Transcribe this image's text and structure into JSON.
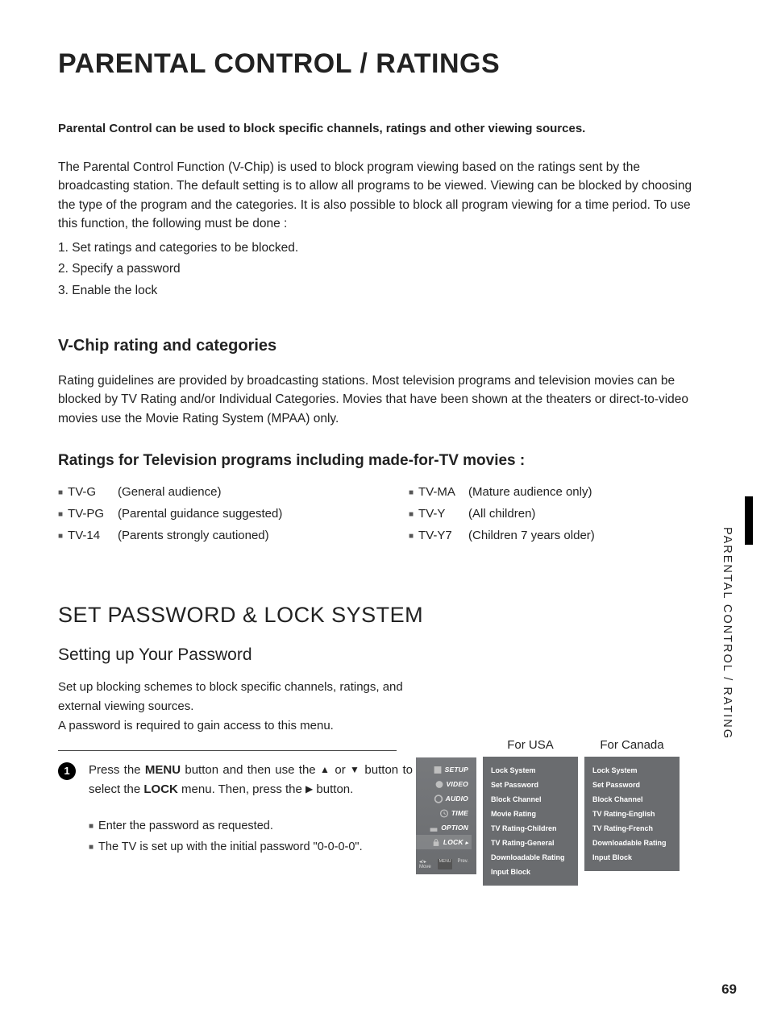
{
  "title": "PARENTAL CONTROL / RATINGS",
  "lead": "Parental Control can be used to block specific channels, ratings and other viewing sources.",
  "intro": "The Parental Control Function (V-Chip) is used to block program viewing based on the ratings sent by the broadcasting station. The default setting is to allow all programs to be viewed. Viewing can be blocked by choosing the type of the program and the categories. It is also possible to block all program viewing for a time period. To use this function, the following must be done :",
  "steps": [
    "1. Set ratings and categories to be blocked.",
    "2. Specify a password",
    "3. Enable the lock"
  ],
  "vchip_heading": "V-Chip rating and categories",
  "vchip_body": "Rating guidelines are provided by broadcasting stations. Most television programs and television movies can be blocked by TV Rating and/or Individual Categories. Movies that have been shown at the theaters or direct-to-video movies use the Movie Rating System (MPAA) only.",
  "ratings_heading": "Ratings for Television programs including made-for-TV movies :",
  "ratings_left": [
    {
      "code": "TV-G",
      "desc": "(General audience)"
    },
    {
      "code": "TV-PG",
      "desc": "(Parental guidance suggested)"
    },
    {
      "code": "TV-14",
      "desc": "(Parents strongly cautioned)"
    }
  ],
  "ratings_right": [
    {
      "code": "TV-MA",
      "desc": "(Mature audience only)"
    },
    {
      "code": "TV-Y",
      "desc": "(All children)"
    },
    {
      "code": "TV-Y7",
      "desc": "(Children 7 years older)"
    }
  ],
  "section2_title": "SET PASSWORD & LOCK SYSTEM",
  "setting_title": "Setting up Your Password",
  "setting_body1": "Set up blocking schemes to block specific channels, ratings, and external viewing sources.",
  "setting_body2": "A password is required to gain access to this menu.",
  "step1_num": "1",
  "step1_a": "Press the ",
  "step1_menu": "MENU",
  "step1_b": " button and then use the ",
  "step1_c": " or ",
  "step1_d": " button to select the ",
  "step1_lock": "LOCK",
  "step1_e": " menu. Then, press the ",
  "step1_f": " button.",
  "step1_sub1": "Enter the password as requested.",
  "step1_sub2": "The TV is set up with the initial password \"0-0-0-0\".",
  "menu_items": [
    "SETUP",
    "VIDEO",
    "AUDIO",
    "TIME",
    "OPTION",
    "LOCK"
  ],
  "menu_footer_move": "Move",
  "menu_footer_prev": "Prev.",
  "region_usa": "For USA",
  "region_canada": "For Canada",
  "usa_options": [
    "Lock System",
    "Set Password",
    "Block Channel",
    "Movie Rating",
    "TV Rating-Children",
    "TV Rating-General",
    "Downloadable Rating",
    "Input Block"
  ],
  "canada_options": [
    "Lock System",
    "Set Password",
    "Block Channel",
    "TV Rating-English",
    "TV Rating-French",
    "Downloadable Rating",
    "Input Block"
  ],
  "side_text": "PARENTAL CONTROL / RATING",
  "page_number": "69",
  "arrow_up": "▲",
  "arrow_down": "▼",
  "arrow_right": "▶"
}
